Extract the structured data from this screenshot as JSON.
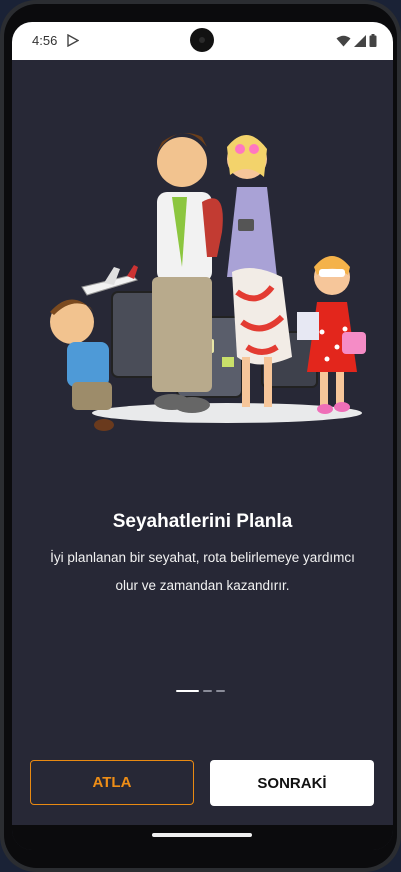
{
  "status_bar": {
    "time": "4:56",
    "icons": [
      "play-store-icon",
      "wifi-icon",
      "signal-icon",
      "battery-icon"
    ]
  },
  "onboarding": {
    "title": "Seyahatlerini Planla",
    "description_line1": "İyi planlanan bir seyahat, rota belirlemeye yardımcı",
    "description_line2": "olur ve zamandan kazandırır.",
    "page_count": 3,
    "current_page": 1
  },
  "buttons": {
    "skip_label": "ATLA",
    "next_label": "SONRAKİ"
  },
  "colors": {
    "background": "#272836",
    "accent": "#ef8e16",
    "text": "#ffffff"
  }
}
